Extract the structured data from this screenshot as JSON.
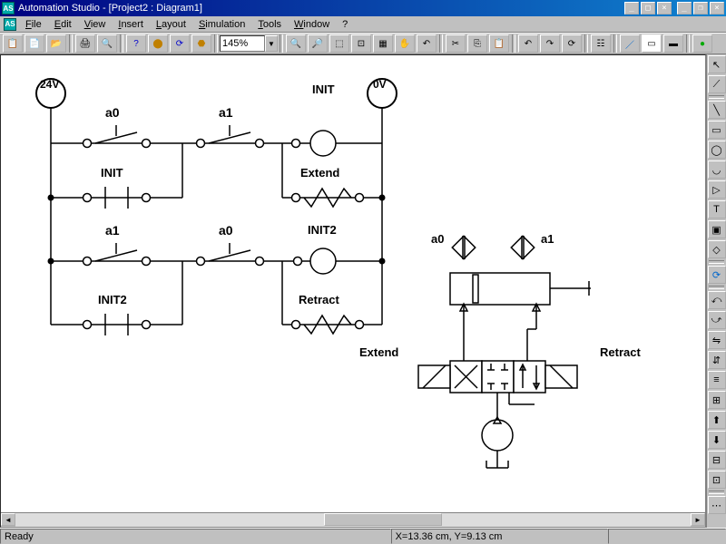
{
  "title": "Automation Studio - [Project2 : Diagram1]",
  "menu": {
    "file": "File",
    "edit": "Edit",
    "view": "View",
    "insert": "Insert",
    "layout": "Layout",
    "simulation": "Simulation",
    "tools": "Tools",
    "window": "Window",
    "help": "?"
  },
  "zoom": "145%",
  "status": {
    "ready": "Ready",
    "coords": "X=13.36 cm, Y=9.13 cm"
  },
  "diagram": {
    "supply24": "24V",
    "supply0": "0V",
    "a0": "a0",
    "a1": "a1",
    "init": "INIT",
    "init2": "INIT2",
    "extend": "Extend",
    "retract": "Retract"
  },
  "chart_data": {
    "type": "diagram",
    "description": "Electro-hydraulic ladder circuit controlling a double-acting cylinder via a 4/3 solenoid valve",
    "supplies": [
      "24V",
      "0V"
    ],
    "rungs": [
      {
        "contacts": [
          {
            "id": "a0",
            "type": "NO-limit"
          },
          {
            "id": "a1",
            "type": "NO-limit"
          }
        ],
        "coil": "INIT"
      },
      {
        "contacts": [
          {
            "id": "INIT",
            "type": "NO-relay"
          }
        ],
        "coil": "Extend"
      },
      {
        "contacts": [
          {
            "id": "a1",
            "type": "NO-limit"
          },
          {
            "id": "a0",
            "type": "NO-limit"
          }
        ],
        "coil": "INIT2"
      },
      {
        "contacts": [
          {
            "id": "INIT2",
            "type": "NO-relay"
          }
        ],
        "coil": "Retract"
      }
    ],
    "hydraulic": {
      "cylinder": {
        "sensors": [
          "a0",
          "a1"
        ]
      },
      "valve": {
        "type": "4/3",
        "solenoids": [
          "Extend",
          "Retract"
        ]
      },
      "pump": true,
      "tank": true
    }
  }
}
